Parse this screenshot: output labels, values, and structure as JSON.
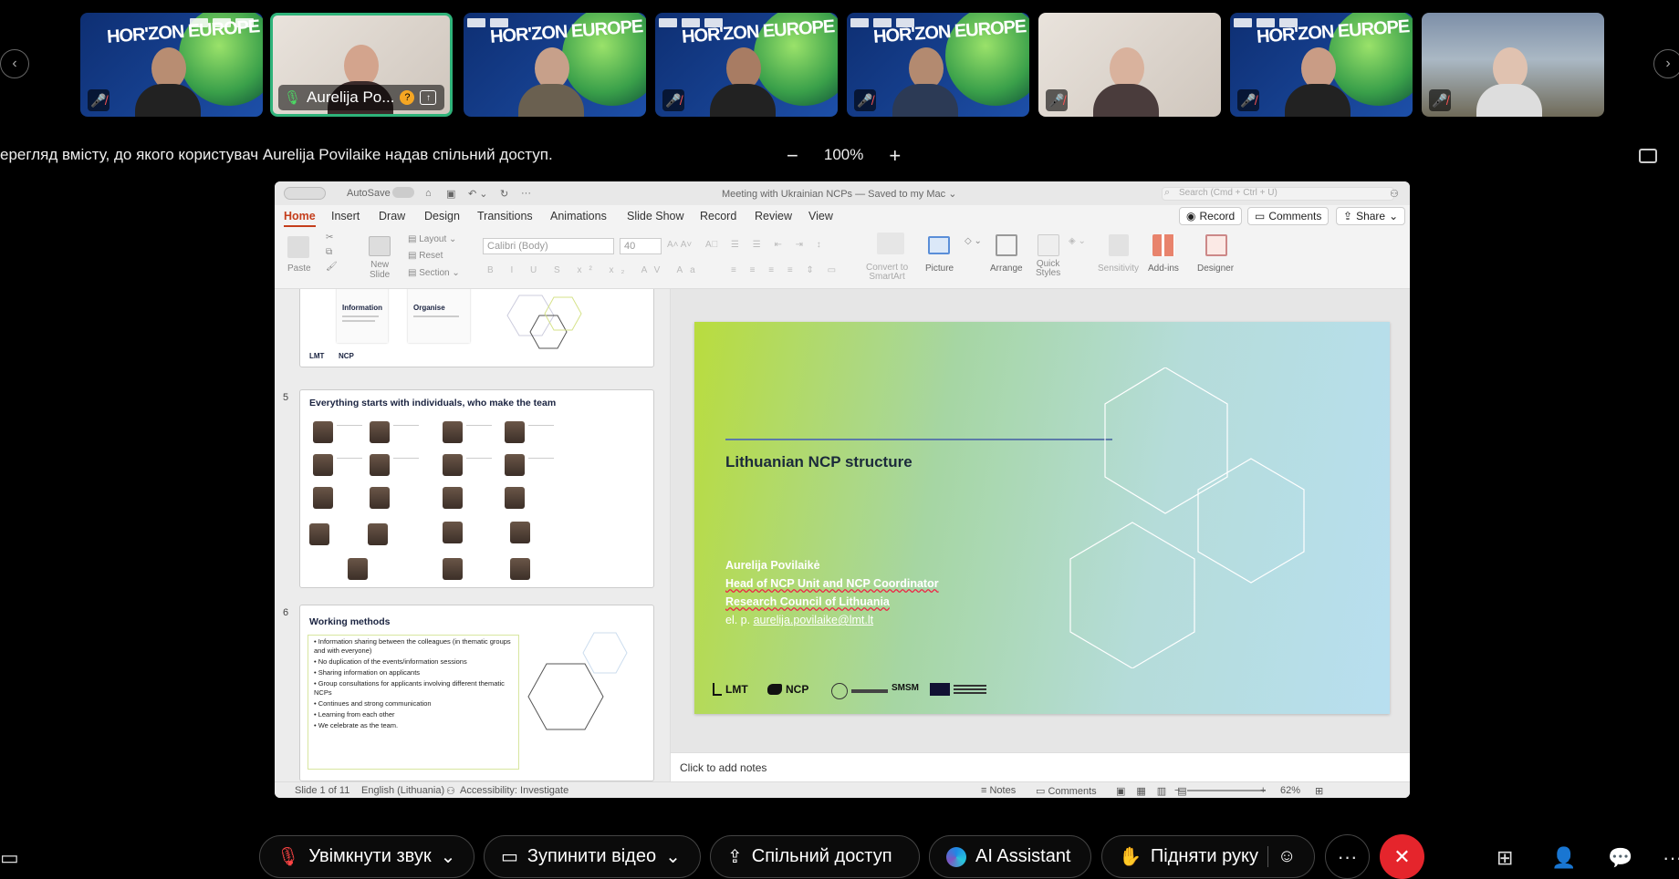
{
  "participants": [
    {
      "name": "",
      "muted": true,
      "bg": "horizon"
    },
    {
      "name": "Aurelija Po...",
      "muted": false,
      "bg": "light",
      "active": true
    },
    {
      "name": "",
      "muted": false,
      "bg": "horizon"
    },
    {
      "name": "",
      "muted": true,
      "bg": "horizon"
    },
    {
      "name": "",
      "muted": true,
      "bg": "horizon"
    },
    {
      "name": "",
      "muted": true,
      "bg": "light"
    },
    {
      "name": "",
      "muted": true,
      "bg": "horizon"
    },
    {
      "name": "",
      "muted": true,
      "bg": "sky"
    }
  ],
  "horizon_text": "HOR'ZON EUROPE",
  "share_notice": "ерегляд вмісту, до якого користувач Aurelija Povilaike надав спільний доступ.",
  "zoom": {
    "minus": "−",
    "level": "100%",
    "plus": "+"
  },
  "ppt": {
    "autosave": "AutoSave",
    "doc_title": "Meeting with Ukrainian NCPs — Saved to my Mac ⌄",
    "search_placeholder": "Search (Cmd + Ctrl + U)",
    "tabs": [
      "Home",
      "Insert",
      "Draw",
      "Design",
      "Transitions",
      "Animations",
      "Slide Show",
      "Record",
      "Review",
      "View"
    ],
    "record_btn": "Record",
    "comments_btn": "Comments",
    "share_btn": "Share",
    "ribbon": {
      "paste": "Paste",
      "new_slide": "New\nSlide",
      "layout": "Layout",
      "reset": "Reset",
      "section": "Section",
      "font": "Calibri (Body)",
      "size": "40",
      "convert": "Convert to\nSmartArt",
      "picture": "Picture",
      "arrange": "Arrange",
      "quick_styles": "Quick\nStyles",
      "sensitivity": "Sensitivity",
      "addins": "Add-ins",
      "designer": "Designer"
    },
    "thumbs": {
      "t4_info": "Information",
      "t4_org": "Organise",
      "t5_num": "5",
      "t5_title": "Everything starts with individuals, who make the team",
      "t6_num": "6",
      "t6_title": "Working methods",
      "t6_bullets": [
        "Information sharing between the colleagues (in thematic groups and with everyone)",
        "No duplication of the events/information sessions",
        "Sharing information on applicants",
        "Group consultations for applicants involving different thematic NCPs",
        "Continues and strong communication",
        "Learning from each other",
        "We celebrate as the team."
      ],
      "logo_lmt": "LMT",
      "logo_ncp": "NCP"
    },
    "slide": {
      "title": "Lithuanian NCP structure",
      "name": "Aurelija Povilaikė",
      "role": "Head of NCP Unit and NCP Coordinator",
      "org": "Research Council of Lithuania",
      "email_prefix": "el. p.",
      "email": "aurelija.povilaike@lmt.lt",
      "logo_lmt": "LMT",
      "logo_ncp": "NCP",
      "logo_smsm": "SMSM"
    },
    "notes_placeholder": "Click to add notes",
    "status": {
      "slide": "Slide 1 of 11",
      "lang": "English (Lithuania)",
      "access": "Accessibility: Investigate",
      "notes": "Notes",
      "comments": "Comments",
      "zoom": "62%"
    }
  },
  "toolbar": {
    "unmute": "Увімкнути звук",
    "stop_video": "Зупинити відео",
    "share": "Спільний доступ",
    "ai": "AI Assistant",
    "raise_hand": "Підняти руку",
    "more": "···",
    "leave": "✕"
  },
  "colors": {
    "accent_green": "#2fb37a",
    "leave_red": "#e5252c",
    "ppt_red": "#c43e1c"
  }
}
